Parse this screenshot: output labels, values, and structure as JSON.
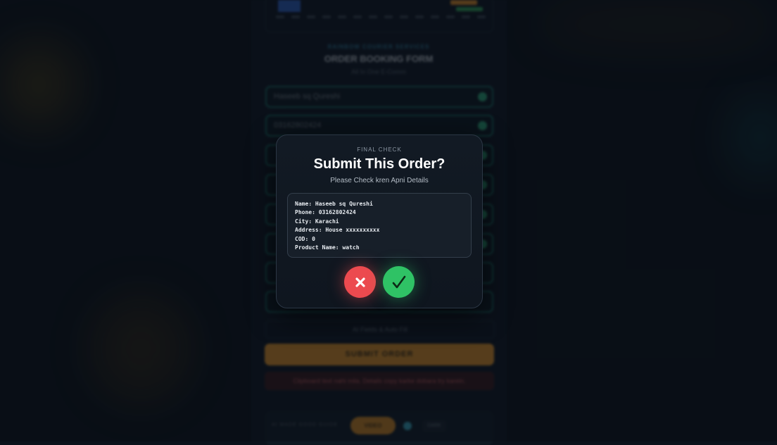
{
  "background": {
    "brand_kicker": "RAINBOW COURIER SERVICES",
    "form_title": "ORDER BOOKING FORM",
    "form_subtitle": "All In One E-Comm",
    "fields": [
      {
        "value": "Haseeb sq Qureshi"
      },
      {
        "value": "03162802424"
      },
      {
        "value": ""
      },
      {
        "value": ""
      },
      {
        "value": ""
      },
      {
        "value": ""
      },
      {
        "value": ""
      },
      {
        "value": ""
      }
    ],
    "auto_fill_label": "AI Fields & Auto Fill",
    "submit_label": "SUBMIT ORDER",
    "warning_text": "Clipboard text nahi mila. Details copy karke dobara try karein.",
    "footer_label": "AI MADE GOOD GUIDE",
    "footer_pill": "VIDEO",
    "footer_right": "DARK"
  },
  "modal": {
    "kicker": "FINAL CHECK",
    "title": "Submit This Order?",
    "subtitle": "Please Check kren Apni Details",
    "details": [
      "Name: Haseeb sq Qureshi",
      "Phone: 03162802424",
      "City: Karachi",
      "Address: House xxxxxxxxxx",
      "COD: 0",
      "Product Name: watch"
    ],
    "cancel_icon": "close-icon",
    "confirm_icon": "check-icon",
    "colors": {
      "cancel": "#ec4a4f",
      "confirm": "#2fc265"
    }
  }
}
